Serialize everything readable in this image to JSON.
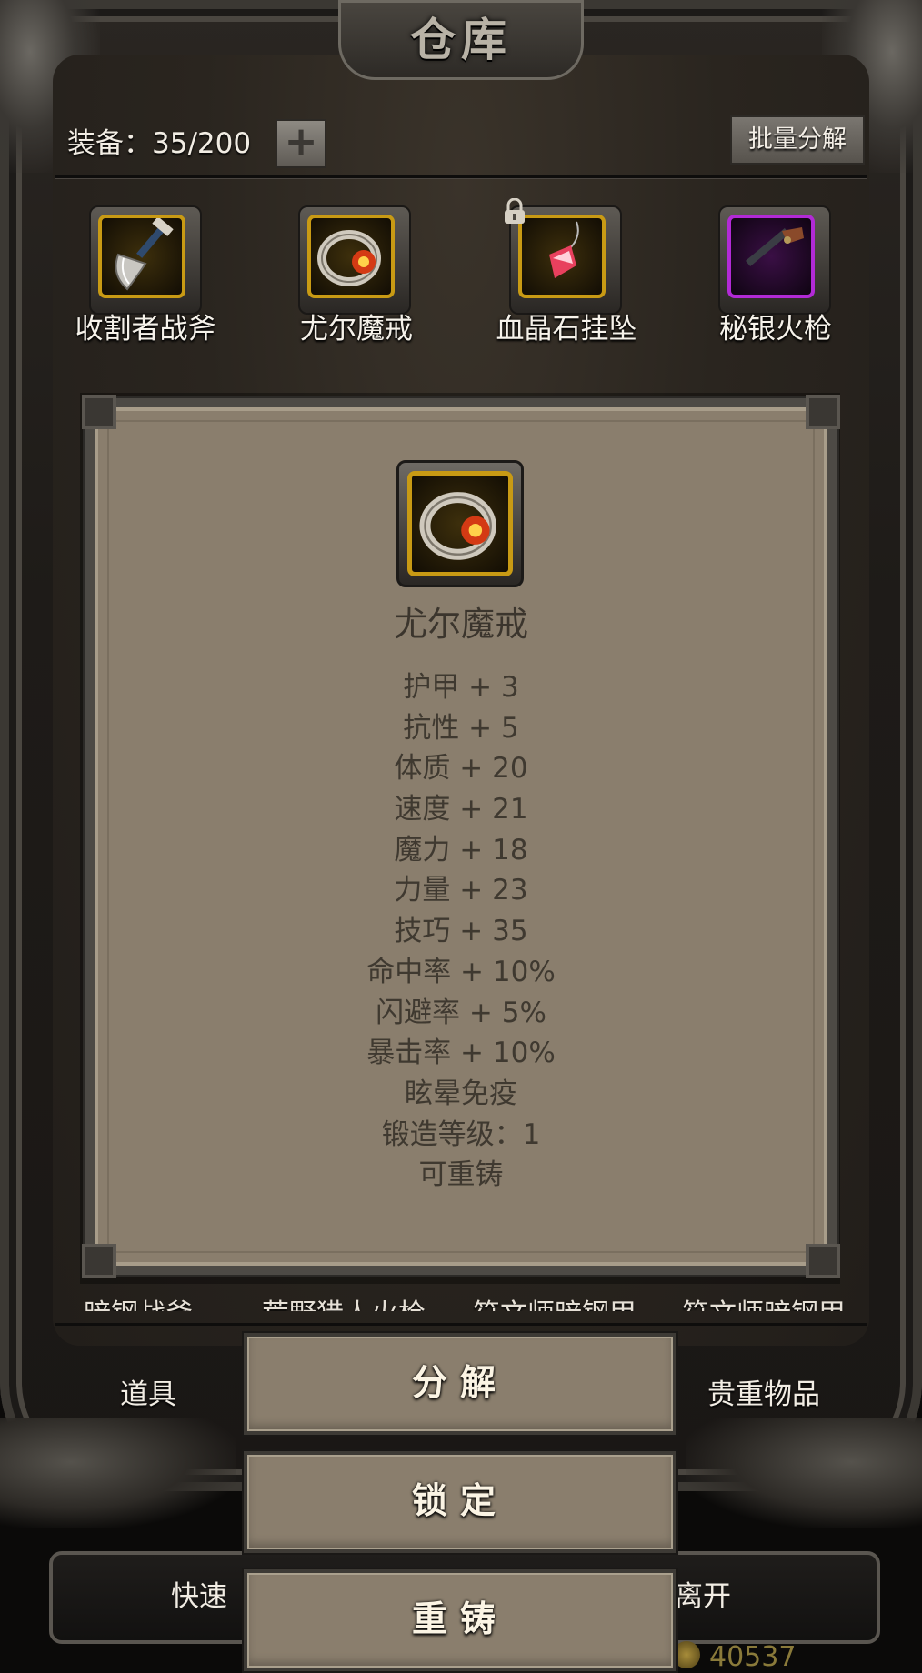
{
  "title": "仓库",
  "header": {
    "equip_label": "装备：35/200",
    "expand_icon": "plus-icon",
    "batch_button": "批量分解"
  },
  "equipped": [
    {
      "name": "收割者战斧",
      "rarity": "gold",
      "icon": "axe-icon"
    },
    {
      "name": "尤尔魔戒",
      "rarity": "gold",
      "icon": "ring-icon"
    },
    {
      "name": "血晶石挂坠",
      "rarity": "gold",
      "icon": "pendant-icon",
      "locked": true
    },
    {
      "name": "秘银火枪",
      "rarity": "purple",
      "icon": "musket-icon"
    }
  ],
  "list_partial": [
    "暗钢战斧",
    "荒野猎人火枪",
    "符文师暗钢甲",
    "符文师暗钢甲"
  ],
  "popup": {
    "item_name": "尤尔魔戒",
    "stats": [
      "护甲 + 3",
      "抗性 + 5",
      "体质 + 20",
      "速度 + 21",
      "魔力 + 18",
      "力量 + 23",
      "技巧 + 35",
      "命中率 + 10%",
      "闪避率 + 5%",
      "暴击率 + 10%",
      "眩晕免疫",
      "锻造等级：1",
      "可重铸"
    ]
  },
  "tabs": {
    "items": "道具",
    "valuables": "贵重物品"
  },
  "actions": {
    "decompose": "分解",
    "lock": "锁定",
    "reforge": "重铸"
  },
  "bottom_bar": {
    "quick_partial": "快速",
    "leave_partial": "离开",
    "gold_partial": "40537"
  },
  "colors": {
    "gold_rarity": "#c89a14",
    "purple_rarity": "#b22ad6",
    "popup_bg": "#8a7e6d"
  }
}
